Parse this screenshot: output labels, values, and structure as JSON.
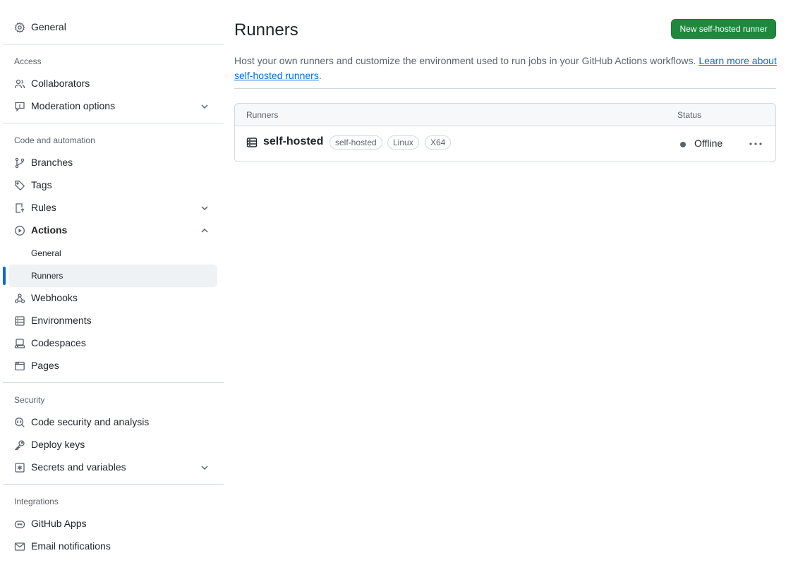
{
  "sidebar": {
    "general": "General",
    "sections": {
      "access": "Access",
      "code_automation": "Code and automation",
      "security": "Security",
      "integrations": "Integrations"
    },
    "items": {
      "collaborators": "Collaborators",
      "moderation": "Moderation options",
      "branches": "Branches",
      "tags": "Tags",
      "rules": "Rules",
      "actions": "Actions",
      "actions_general": "General",
      "actions_runners": "Runners",
      "webhooks": "Webhooks",
      "environments": "Environments",
      "codespaces": "Codespaces",
      "pages": "Pages",
      "code_security": "Code security and analysis",
      "deploy_keys": "Deploy keys",
      "secrets": "Secrets and variables",
      "github_apps": "GitHub Apps",
      "email_notifications": "Email notifications"
    }
  },
  "main": {
    "title": "Runners",
    "new_button": "New self-hosted runner",
    "description": "Host your own runners and customize the environment used to run jobs in your GitHub Actions workflows.",
    "learn_more": "Learn more about self-hosted runners",
    "period": ".",
    "table": {
      "col_runners": "Runners",
      "col_status": "Status",
      "runner": {
        "name": "self-hosted",
        "labels": [
          "self-hosted",
          "Linux",
          "X64"
        ],
        "status": "Offline"
      }
    }
  },
  "colors": {
    "accent": "#0969da",
    "primary_button": "#1f883d",
    "muted": "#59636e",
    "border": "#d1d9e0"
  }
}
